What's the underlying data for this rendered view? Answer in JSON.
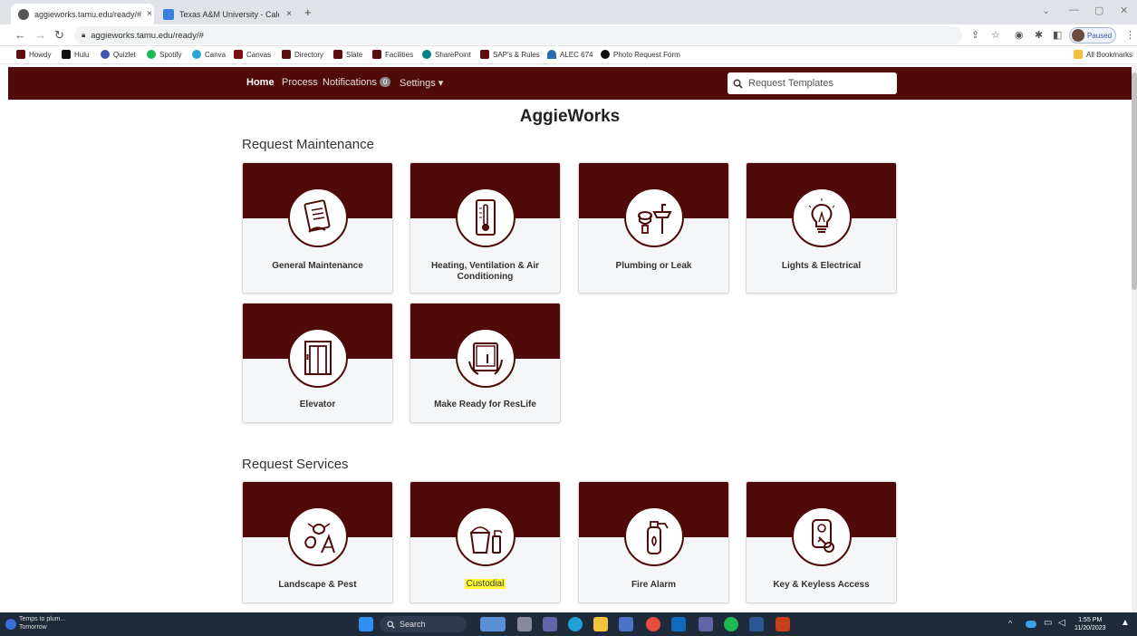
{
  "browser": {
    "tabs": [
      {
        "title": "aggieworks.tamu.edu/ready/#",
        "close": "×"
      },
      {
        "title": "Texas A&M University - Calenda",
        "close": "×"
      }
    ],
    "new_tab": "+",
    "url": "aggieworks.tamu.edu/ready/#",
    "profile_status": "Paused",
    "bookmarks": [
      "Howdy",
      "Hulu",
      "Quizlet",
      "Spotify",
      "Canva",
      "Canvas",
      "Directory",
      "Slate",
      "Facilities",
      "SharePoint",
      "SAP's & Rules",
      "ALEC 674",
      "Photo Request Form"
    ],
    "all_bookmarks": "All Bookmarks"
  },
  "site": {
    "nav": {
      "home": "Home",
      "process": "Process",
      "notifications": "Notifications",
      "notifications_count": "0",
      "settings": "Settings ▾"
    },
    "search_placeholder": "Request Templates",
    "title": "AggieWorks",
    "sections": {
      "maintenance": "Request Maintenance",
      "services": "Request Services"
    },
    "maintenance_cards": [
      {
        "label": "General Maintenance",
        "icon": "clipboard-icon"
      },
      {
        "label": "Heating, Ventilation & Air Conditioning",
        "icon": "thermometer-icon"
      },
      {
        "label": "Plumbing or Leak",
        "icon": "plumbing-icon"
      },
      {
        "label": "Lights & Electrical",
        "icon": "lightbulb-icon"
      },
      {
        "label": "Elevator",
        "icon": "elevator-icon"
      },
      {
        "label": "Make Ready for ResLife",
        "icon": "tablet-icon"
      }
    ],
    "service_cards": [
      {
        "label": "Landscape & Pest",
        "icon": "bug-icon"
      },
      {
        "label": "Custodial",
        "icon": "bucket-icon",
        "highlight": "#ffff33"
      },
      {
        "label": "Fire Alarm",
        "icon": "extinguisher-icon"
      },
      {
        "label": "Key & Keyless Access",
        "icon": "key-icon"
      }
    ],
    "accent": "#4f0a09"
  },
  "taskbar": {
    "weather_line1": "Temps to plum...",
    "weather_line2": "Tomorrow",
    "search": "Search",
    "time": "1:55 PM",
    "date": "11/20/2023"
  }
}
